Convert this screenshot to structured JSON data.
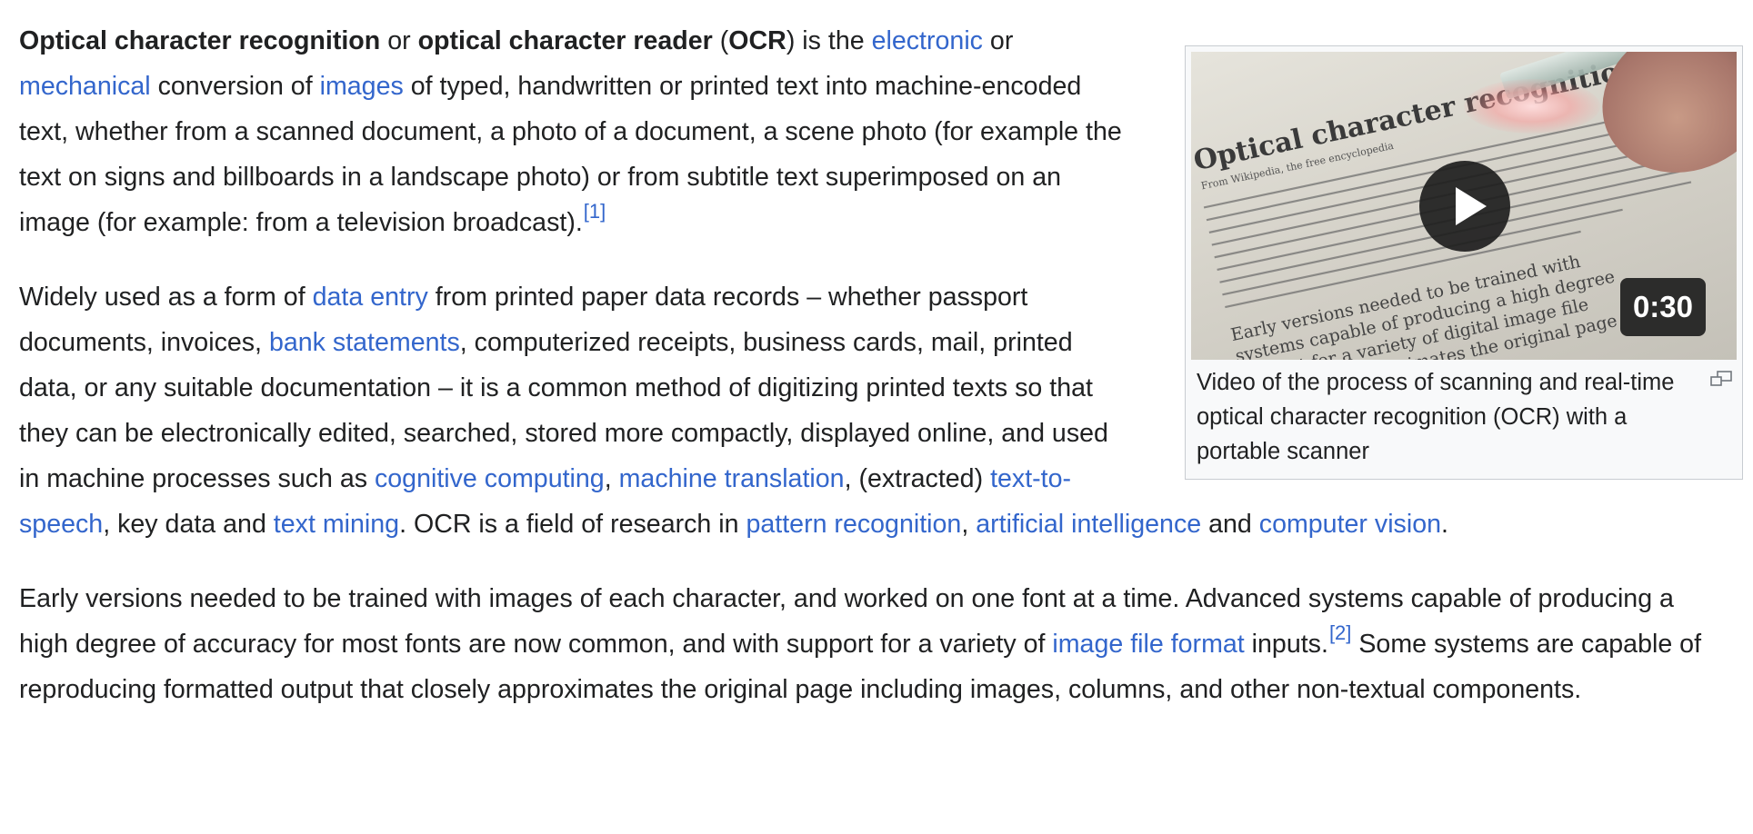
{
  "p1": {
    "b1": "Optical character recognition",
    "t1": " or ",
    "b2": "optical character reader",
    "t2": " (",
    "b3": "OCR",
    "t3": ") is the ",
    "l1": "electronic",
    "t4": " or ",
    "l2": "mechanical",
    "t5": " conversion of ",
    "l3": "images",
    "t6": " of typed, handwritten or printed text into machine-encoded text, whether from a scanned document, a photo of a document, a scene photo (for example the text on signs and billboards in a landscape photo) or from subtitle text superimposed on an image (for example: from a television broadcast).",
    "ref": "[1]"
  },
  "p2": {
    "t1": "Widely used as a form of ",
    "l1": "data entry",
    "t2": " from printed paper data records – whether passport documents, invoices, ",
    "l2": "bank statements",
    "t3": ", computerized receipts, business cards, mail, printed data, or any suitable documentation – it is a common method of digitizing printed texts so that they can be electronically edited, searched, stored more compactly, displayed online, and used in machine processes such as ",
    "l3": "cognitive computing",
    "t4": ", ",
    "l4": "machine translation",
    "t5": ", (extracted) ",
    "l5": "text-to-speech",
    "t6": ", key data and ",
    "l6": "text mining",
    "t7": ". OCR is a field of research in ",
    "l7": "pattern recognition",
    "t8": ", ",
    "l8": "artificial intelligence",
    "t9": " and ",
    "l9": "computer vision",
    "t10": "."
  },
  "p3": {
    "t1": "Early versions needed to be trained with images of each character, and worked on one font at a time. Advanced systems capable of producing a high degree of accuracy for most fonts are now common, and with support for a variety of ",
    "l1": "image file format",
    "t2": " inputs.",
    "ref": "[2]",
    "t3": " Some systems are capable of reproducing formatted output that closely approximates the original page including images, columns, and other non-textual components."
  },
  "thumb": {
    "duration": "0:30",
    "caption": "Video of the process of scanning and real-time optical character recognition (OCR) with a portable scanner",
    "poster_heading": "Optical character recognition",
    "poster_sub": "From Wikipedia, the free encyclopedia",
    "poster_line1": "Early versions needed to be trained with",
    "poster_line2": "systems capable of producing a high degree",
    "poster_line3": "support for a variety of digital image file",
    "poster_line4": "that closely approximates the original page"
  },
  "colors": {
    "link": "#3366cc",
    "text": "#202122",
    "thumb_border": "#c8ccd1",
    "thumb_bg": "#f8f9fa"
  },
  "icons": {
    "play": "play-icon",
    "enlarge": "enlarge-icon"
  }
}
